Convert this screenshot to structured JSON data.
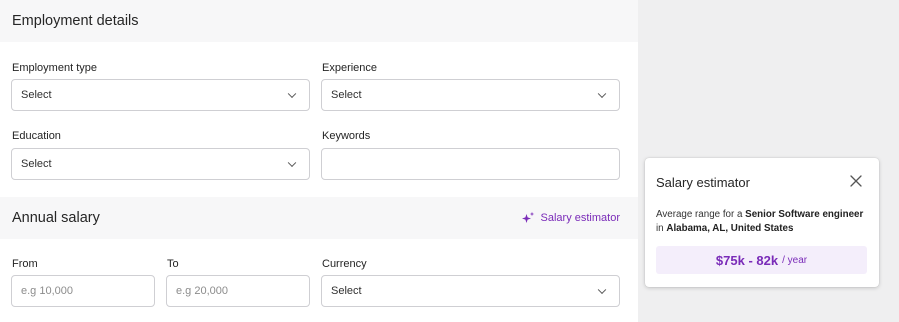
{
  "employment": {
    "title": "Employment details",
    "type": {
      "label": "Employment type",
      "value": "Select"
    },
    "experience": {
      "label": "Experience",
      "value": "Select"
    },
    "education": {
      "label": "Education",
      "value": "Select"
    },
    "keywords": {
      "label": "Keywords",
      "value": ""
    }
  },
  "salary": {
    "title": "Annual salary",
    "estimator_link": "Salary estimator",
    "from": {
      "label": "From",
      "placeholder": "e.g 10,000"
    },
    "to": {
      "label": "To",
      "placeholder": "e.g 20,000"
    },
    "currency": {
      "label": "Currency",
      "value": "Select"
    }
  },
  "estimator_card": {
    "title": "Salary estimator",
    "desc_prefix": "Average range for a",
    "job_title": "Senior Software engineer",
    "desc_in": "in",
    "location": "Alabama, AL, United States",
    "range": "$75k - 82k",
    "unit": "/ year"
  },
  "colors": {
    "accent": "#7a2bb8",
    "accent_bg": "#f4eefb",
    "section_bg": "#f7f7f8",
    "page_bg": "#efeff0"
  },
  "icons": {
    "dropdown": "chevron-down-icon",
    "estimator": "sparkle-icon",
    "close": "close-icon"
  }
}
